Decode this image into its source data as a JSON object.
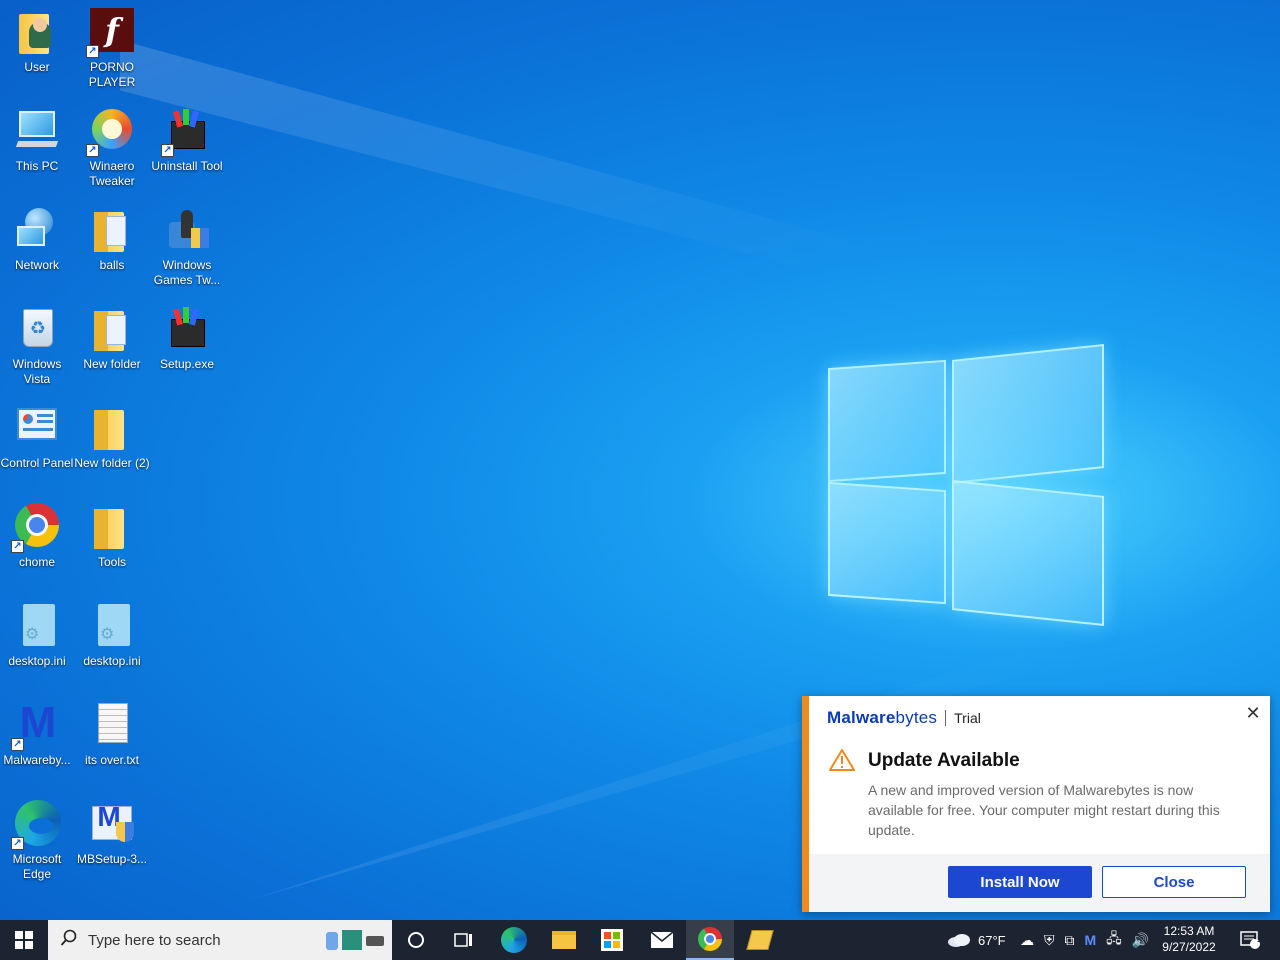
{
  "desktop": {
    "icons": [
      {
        "label": "User",
        "icon": "user-folder-icon"
      },
      {
        "label": "PORNO PLAYER",
        "icon": "flash-player-icon"
      },
      {
        "label": "This PC",
        "icon": "computer-icon"
      },
      {
        "label": "Winaero Tweaker",
        "icon": "winaero-tweaker-icon"
      },
      {
        "label": "Uninstall Tool",
        "icon": "installer-box-icon"
      },
      {
        "label": "Network",
        "icon": "network-globe-icon"
      },
      {
        "label": "balls",
        "icon": "folder-doc-icon"
      },
      {
        "label": "Windows Games Tw...",
        "icon": "games-tweaker-icon"
      },
      {
        "label": "Windows Vista",
        "icon": "recycle-bin-icon"
      },
      {
        "label": "New folder",
        "icon": "folder-doc-icon"
      },
      {
        "label": "Setup.exe",
        "icon": "installer-box-icon"
      },
      {
        "label": "Control Panel",
        "icon": "control-panel-icon"
      },
      {
        "label": "New folder (2)",
        "icon": "folder-icon"
      },
      {
        "label": "chome",
        "icon": "chrome-icon"
      },
      {
        "label": "Tools",
        "icon": "folder-icon"
      },
      {
        "label": "desktop.ini",
        "icon": "settings-file-icon"
      },
      {
        "label": "desktop.ini",
        "icon": "settings-file-icon"
      },
      {
        "label": "Malwareby...",
        "icon": "malwarebytes-icon"
      },
      {
        "label": "its over.txt",
        "icon": "text-file-icon"
      },
      {
        "label": "Microsoft Edge",
        "icon": "edge-icon"
      },
      {
        "label": "MBSetup-3...",
        "icon": "mbsetup-icon"
      }
    ]
  },
  "notification": {
    "brand_bold": "Malware",
    "brand_thin": "bytes",
    "tag": "Trial",
    "title": "Update Available",
    "body": "A new and improved version of Malwarebytes is now available for free. Your computer might restart during this update.",
    "primary_label": "Install Now",
    "secondary_label": "Close",
    "close_glyph": "✕",
    "accent_color": "#f08a1c",
    "brand_color": "#1b47d1"
  },
  "taskbar": {
    "search_placeholder": "Type here to search",
    "weather": "67°F",
    "time": "12:53 AM",
    "date": "9/27/2022",
    "notification_count": "1",
    "pinned": [
      "cortana-icon",
      "task-view-icon",
      "edge-icon",
      "file-explorer-icon",
      "store-icon",
      "mail-icon",
      "chrome-icon",
      "app-icon"
    ]
  }
}
